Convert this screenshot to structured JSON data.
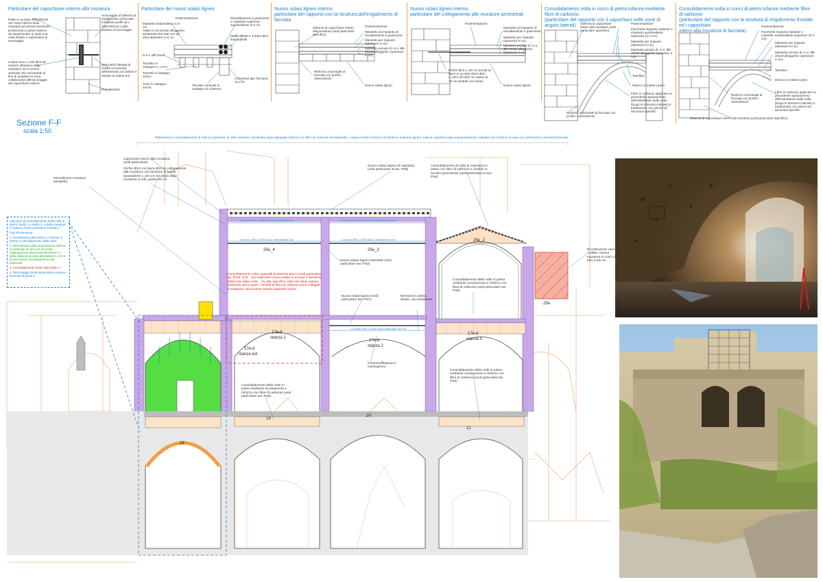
{
  "details": [
    {
      "title": [
        "Particolare del capochiave interno alla muratura"
      ],
      "labels": [
        "Piatto in acciaio 300x300x10 nel corpo interno della muratura a/s previa rimozione di elementi in pietra esterno da riposizionare in sede una volta fissato il capochiave di ancoraggio",
        "Ancoraggio al sistema di irrigidimento di facciata mediante profili ad L 150x100x10 o altro sistema di ancoraggio",
        "4 barre inox L=100 Ø16 da inserire all'interno della muratura, sia in senso verticale che orizzontale al fine di ampliare la zona collaborante dell'ancoraggio del capochiave interno",
        "Barra Ø24 filettata di classe 8.8 serrata all'estremità con bulloni e rosette di classe 8.8",
        "Riempimento"
      ]
    },
    {
      "title": [
        "Particolare del nuovo solaio ligneo"
      ],
      "labels": [
        "Pavimentazione",
        "Massetto impiantistico s=6 cm",
        "Getto in cls armato alleggerito strutturale Rck 250 con ad elica spessore s=6 cm",
        "R.e.s. Ø6 20x20",
        "Tavolato in castagno s =3 cm",
        "Travetti in castagno 12x12",
        "Travi in castagno 24x24",
        "Riscaldamento a pavimento e massetto superiore autolivellante 3+3 cm",
        "Staffa Ø8/20 e 4 barre Ø12 longitudinali",
        "Tavolato verticale in castagno di chiusura",
        "Connettori tipo Tecnaria 12.175"
      ]
    },
    {
      "title": [
        "Nuovo solaio ligneo interno,",
        "particolare del rapporto con la struttura dell'irrigidimento di facciata"
      ],
      "labels": [
        "Sistema di capochiave interni alla muratura (vedi particolare specifico)",
        "Pavimentazione",
        "Massetto ed impianto di riscaldamento a pavimento",
        "Massetto per impianti (spessore 6 cm)",
        "Massetto armato di r.e.s. Ø6 20x20 alleggerito (spessore 4 cm)",
        "Rinforzo orizzontale di facciata con profili L 150x100x10",
        "Nuovo solaio ligneo"
      ]
    },
    {
      "title": [
        "Nuovo solaio ligneo interno,",
        "particolare del collegamento alle murature perimetrali"
      ],
      "labels": [
        "Pavimentazione",
        "Massetto ed impianto di riscaldamento a pavimento",
        "Massetto per impianti (spessore 6 cm)",
        "Massetto armato di r.e.s. Ø6 20x20 alleggerito (spessore 4 cm)",
        "Perfori Ø12 L=40 cm armati di barre in acciaio INOX Ø10 L=100 (40+60) con passo di 75 cm iniettati con resine",
        "Nuovo solaio ligneo"
      ]
    },
    {
      "title": [
        "Consolidamento volta in conci di pietra tufacea mediante fibre di carbonio",
        "(particolare del rapporto con il capochiavi nelle zone di angolo laterali)"
      ],
      "labels": [
        "Sistema di capochiave interni alla muratura (vedi particolare specifico)",
        "Pavimentazione",
        "Pacchetto impianto radiante e massetto autolivellante superiore (3+3 cm)",
        "Massetto per impianti (spessore 6 cm)",
        "Massetto armato di r.e.s. Ø6 20x20 alleggerito (spessore 4 cm)",
        "Tavelloni",
        "Muricci in mattoni pieni",
        "Fibre in carbonio applicate su precedente spianamento dell'estradosso della volta (lungo le direzioni indicate) e trattamento con primer ed ancoranti specifici",
        "Rinforzo orizzontale di facciata con profili L 150x100x10"
      ]
    },
    {
      "title": [
        "Consolidamento volta in conci di pietra tufacea mediante fibre di carbonio",
        "(particolare del rapporto con la struttura di irrigidimento frontale ed i capochiavi",
        "interni alla muratura di facciata)"
      ],
      "labels": [
        "Pavimentazione",
        "Pacchetto impianto radiante e massetto autolivellante superiore (3+3 cm)",
        "Massetto per impianti (spessore 6 cm)",
        "Massetto armato di r.e.s. Ø6 20x20 alleggerito (spessore 4 cm)",
        "Tavelloni",
        "Muricci in mattoni pieni",
        "Rinforzo orizzontale di facciata con profili L 150x100x10",
        "Fibre in carbonio applicate su precedente spianamento dell'estradosso della volta (lungo le direzioni indicate) e trattamento con primer ed ancoranti specifici",
        "Sistema di capochiave interni alla muratura (vedi particolare specifico)"
      ]
    }
  ],
  "section": {
    "title": "Sezione F-F",
    "scale": "scala 1:50",
    "top_note": "Rifacimento e consolidamento di tutta la copertura: le volte verranno ripristinate dopo adeguato rinforzo con fibre di carbonio estradossale, i campi cordoli verranno ricostruiti in ordinaria ligneo; tutta la copertura sarà adeguatamente collegata tra cordoli in acciaio con perforazioni perimetrali armate"
  },
  "legend": {
    "title": "Interventi di consolidamento delle volte in pietra, livello 1 e livello 2, e della muratura in mattoni di tufo picchetti 8-9 livello 1",
    "phase_label": "Fasi di intervento:",
    "phases": [
      {
        "text": "1. Puntellatura volta livello 2, rimessa in forma e consolidamento della volta;",
        "color": "blue"
      },
      {
        "text": "2. Demolizione della tamponatura esterna in materiale di tufo con accurata catalogazione degli elementi tufacei, e della scala di accesso alla stanza 1-17e-d di successivo accatastamento del materiale;",
        "color": "green"
      },
      {
        "text": "3. Consolidamento della volta livello 1;",
        "color": "red"
      },
      {
        "text": "4. Rimontaggio della tamponatura esterna, seconda la punto 2.",
        "color": "blue"
      }
    ]
  },
  "annotations": [
    {
      "id": "demolizione",
      "text": "Demolizione muratura parapetto"
    },
    {
      "id": "capochiavi",
      "text": "Capochiavi interni alla muratura (vedi particolare)"
    },
    {
      "id": "perfori",
      "text": "Perfori Ø12 con barre Ø10 di collegamento alla muratura con iniezione di resine epossidiche L=40 cm nel corpo della muratura in tufo, passo 60 cm"
    },
    {
      "id": "nuovo-solaio-copertura",
      "text": "Nuovo solaio ligneo di copertura (vedi particolare B tav. PS6)"
    },
    {
      "id": "consolidamento-copertura",
      "text": "Consolidamento di volta di copertura in pietra con fibre di carbonio e cordolo in acciaio perimetrale (vedi particolare D tav. PS6)"
    },
    {
      "id": "ricostruzione",
      "text": "Ricostruzione vano crollato: Nuova muratura in conci di tufo s=25 cm"
    },
    {
      "id": "solaio-sottotetto",
      "text": "Nuovo solaio ligneo sottotetto (vedi particolare tav. PS3)"
    },
    {
      "id": "solaio-ps7",
      "text": "Nuovo solaio ligneo (vedi particolare tav. PS7)"
    },
    {
      "id": "elementi-pietra",
      "text": "Elementi in pietra, sbalzo, da mantenere"
    },
    {
      "id": "volte-stanza3",
      "text": "Consolidamento delle volte in pietra mediante svuotamento e rinforzo con fibre di carbonio (vedi particolare tav. PS6)"
    },
    {
      "id": "controsoffitto",
      "text": "Controsoffittatura in cartongesso"
    },
    {
      "id": "volte-19",
      "text": "Consolidamento delle volte in pietra mediante svuotamento e rinforzo con fibre di carbonio (vedi particolare tav. PS6)"
    },
    {
      "id": "volte-21",
      "text": "Consolidamento delle volte in pietra mediante svuotamento e rinforzo con fibre di carbonio (vedi particolare tav. PS6)"
    }
  ],
  "red_note": "Consolidamento volte i pannelli di laterizio pieno (vedi particolare tav. PS2). N.B. - Da realizzare nuovo solaio in acciaio e tavellone distaccato dalla volta; - Su tale specifica volta non deve essere realizzato alcun getto; i tessuti di fibra di carbonio sono collegati al substrato unicamente tramite apposite resine",
  "beam_labels": [
    "Cordolo UPE 170/35 20x20 interasse 65 cm",
    "Cordolo UPE 170/35 20x20 interasse 65 cm",
    "Cordolo UPE 170/35 18x10 interasse 80 cm",
    "Cordolo UPE 170/35 28x12 interasse 80 cm",
    "Cordolo UPE 170/35 24x24 interasse 240 cm"
  ],
  "rooms": {
    "r25_4": "25e_4",
    "r25_3": "25e_3",
    "r25_2": "25e_2",
    "r25e": "25e",
    "s1a": "17e-d",
    "s1b": "stanza 1",
    "sest_a": "17e-d",
    "sest_b": "stanza est",
    "s2a": "17e-d",
    "s2b": "stanza 2",
    "s3a": "17e-d",
    "s3b": "stanza 3",
    "r18": "18",
    "r19": "19",
    "r20": "20",
    "r21": "21"
  },
  "colors": {
    "accent": "#1a7fd0",
    "outline": "#e8a060",
    "purple": "#c8a8e8",
    "green": "#55dd44",
    "yellow": "#ffe000",
    "red": "#dd2222",
    "grey": "#bdbdbd"
  }
}
